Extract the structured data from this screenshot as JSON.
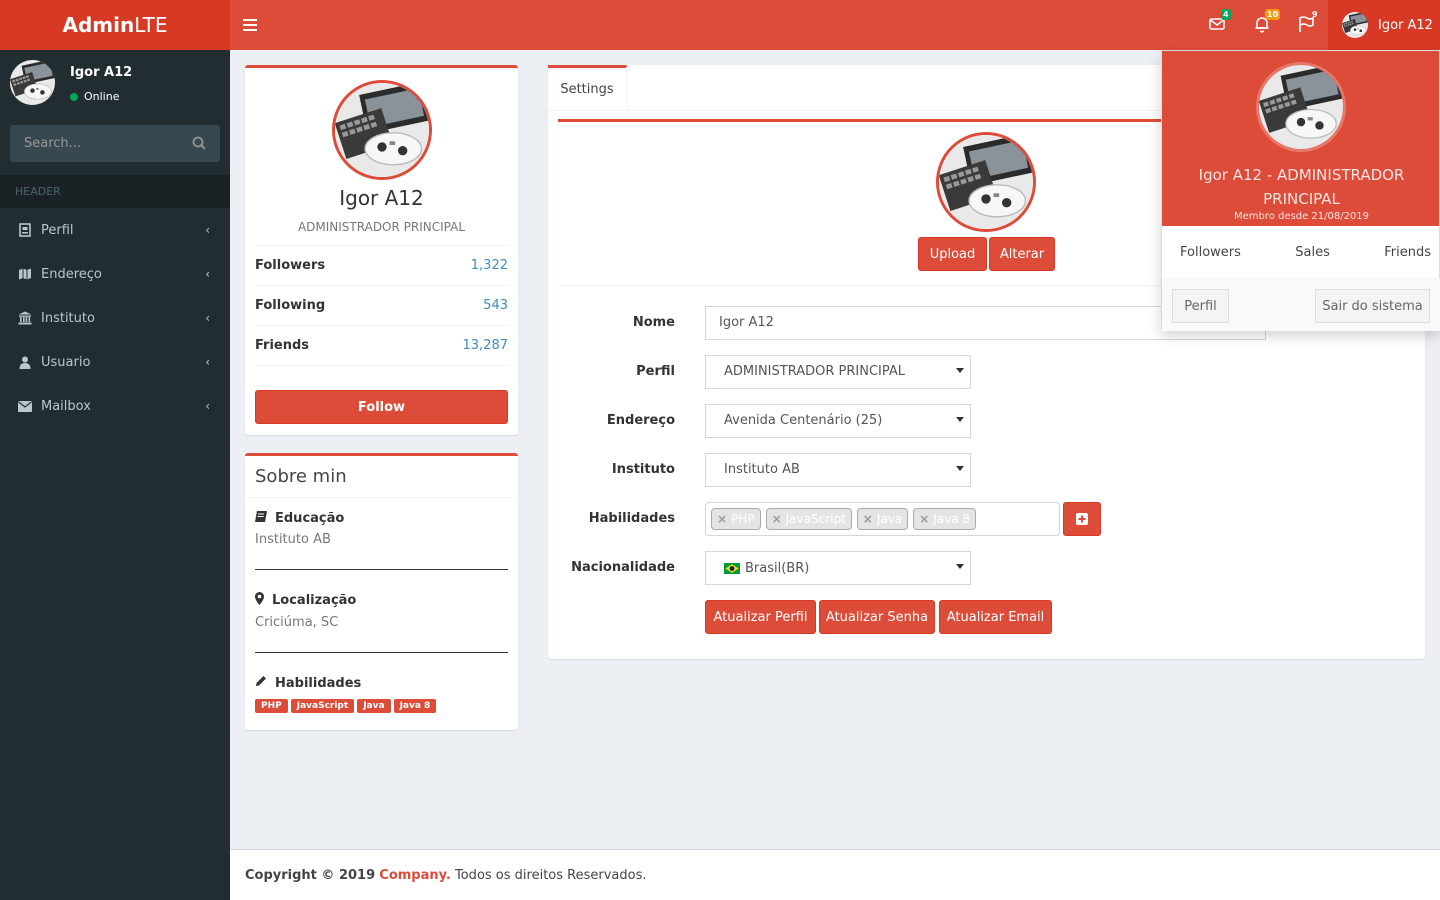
{
  "app": {
    "logo_bold": "Admin",
    "logo_light": "LTE"
  },
  "header": {
    "messages_badge": "4",
    "notifications_badge": "10",
    "tasks_badge": "9",
    "user_name": "Igor A12"
  },
  "sidebar": {
    "user_name": "Igor A12",
    "status": "Online",
    "search_placeholder": "Search...",
    "section_header": "HEADER",
    "items": [
      {
        "label": "Perfil",
        "icon": "badge-icon"
      },
      {
        "label": "Endereço",
        "icon": "map-icon"
      },
      {
        "label": "Instituto",
        "icon": "institution-icon"
      },
      {
        "label": "Usuario",
        "icon": "user-icon"
      },
      {
        "label": "Mailbox",
        "icon": "envelope-icon"
      }
    ]
  },
  "profile_box": {
    "name": "Igor A12",
    "role": "ADMINISTRADOR PRINCIPAL",
    "stats": [
      {
        "label": "Followers",
        "value": "1,322"
      },
      {
        "label": "Following",
        "value": "543"
      },
      {
        "label": "Friends",
        "value": "13,287"
      }
    ],
    "follow_button": "Follow"
  },
  "about_box": {
    "title": "Sobre min",
    "education_label": "Educação",
    "education_value": "Instituto AB",
    "location_label": "Localização",
    "location_value": "Criciúma, SC",
    "skills_label": "Habilidades",
    "skills": [
      "PHP",
      "JavaScript",
      "Java",
      "Java 8"
    ]
  },
  "settings": {
    "tab": "Settings",
    "upload_button": "Upload",
    "change_button": "Alterar",
    "fields": {
      "nome_label": "Nome",
      "nome_value": "Igor A12",
      "perfil_label": "Perfil",
      "perfil_value": "ADMINISTRADOR PRINCIPAL",
      "endereco_label": "Endereço",
      "endereco_value": "Avenida Centenário (25)",
      "instituto_label": "Instituto",
      "instituto_value": "Instituto AB",
      "habilidades_label": "Habilidades",
      "habilidades_tags": [
        "PHP",
        "JavaScript",
        "Java",
        "Java 8"
      ],
      "nacionalidade_label": "Nacionalidade",
      "nacionalidade_value": "Brasil(BR)"
    },
    "buttons": {
      "update_profile": "Atualizar Perfil",
      "update_password": "Atualizar Senha",
      "update_email": "Atualizar Email"
    }
  },
  "user_dropdown": {
    "title": "Igor A12 - ADMINISTRADOR PRINCIPAL",
    "member_since": "Membro desde 21/08/2019",
    "links": [
      "Followers",
      "Sales",
      "Friends"
    ],
    "profile_button": "Perfil",
    "logout_button": "Sair do sistema"
  },
  "footer": {
    "copyright": "Copyright © 2019",
    "company": "Company.",
    "rights": "Todos os direitos Reservados."
  },
  "colors": {
    "brand": "#dd4b39",
    "brand_dark": "#d73925",
    "sidebar": "#222d32",
    "link": "#3c8dbc"
  }
}
